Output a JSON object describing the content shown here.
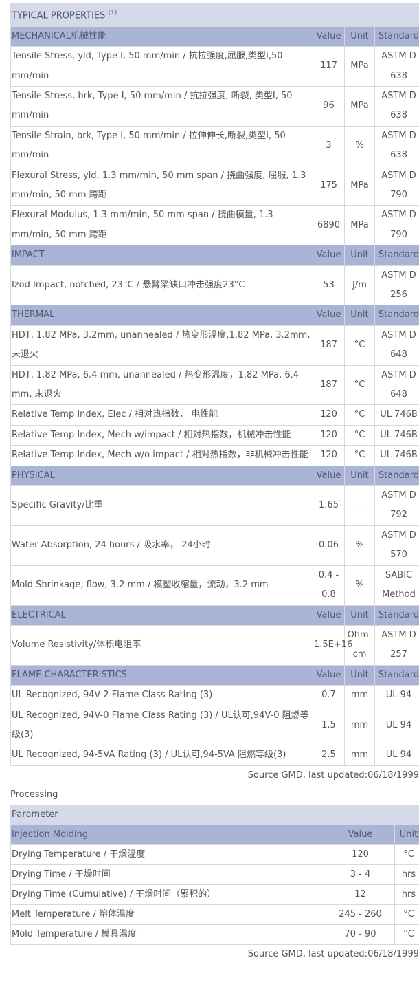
{
  "properties": {
    "title": "TYPICAL PROPERTIES",
    "title_sup": "(1)",
    "sections": [
      {
        "name": "MECHANICAL机械性能",
        "headers": [
          "Value",
          "Unit",
          "Standard"
        ],
        "rows": [
          {
            "name": "Tensile Stress, yld, Type I, 50 mm/min / 抗拉强度,屈服,类型I,50 mm/min",
            "value": "117",
            "unit": "MPa",
            "standard": "ASTM D 638"
          },
          {
            "name": "Tensile Stress, brk, Type I, 50 mm/min / 抗拉强度, 断裂, 类型I, 50 mm/min",
            "value": "96",
            "unit": "MPa",
            "standard": "ASTM D 638"
          },
          {
            "name": "Tensile Strain, brk, Type I, 50 mm/min / 拉伸伸长,断裂,类型I, 50 mm/min",
            "value": "3",
            "unit": "%",
            "standard": "ASTM D 638"
          },
          {
            "name": "Flexural Stress, yld, 1.3 mm/min, 50 mm span / 挠曲强度, 屈服, 1.3 mm/min, 50 mm 跨距",
            "value": "175",
            "unit": "MPa",
            "standard": "ASTM D 790"
          },
          {
            "name": "Flexural Modulus, 1.3 mm/min, 50 mm span / 挠曲模量, 1.3 mm/min, 50 mm 跨距",
            "value": "6890",
            "unit": "MPa",
            "standard": "ASTM D 790"
          }
        ]
      },
      {
        "name": "IMPACT",
        "headers": [
          "Value",
          "Unit",
          "Standard"
        ],
        "rows": [
          {
            "name": "Izod Impact, notched, 23°C / 悬臂梁缺口冲击强度23°C",
            "value": "53",
            "unit": "J/m",
            "standard": "ASTM D 256"
          }
        ]
      },
      {
        "name": "THERMAL",
        "headers": [
          "Value",
          "Unit",
          "Standard"
        ],
        "rows": [
          {
            "name": "HDT, 1.82 MPa, 3.2mm, unannealed / 热变形温度,1.82 MPa, 3.2mm,未退火",
            "value": "187",
            "unit": "°C",
            "standard": "ASTM D 648"
          },
          {
            "name": "HDT, 1.82 MPa, 6.4 mm, unannealed / 热变形温度，1.82 MPa, 6.4 mm, 未退火",
            "value": "187",
            "unit": "°C",
            "standard": "ASTM D 648"
          },
          {
            "name": "Relative Temp Index, Elec / 相对热指数， 电性能",
            "value": "120",
            "unit": "°C",
            "standard": "UL 746B"
          },
          {
            "name": "Relative Temp Index, Mech w/impact / 相对热指数，机械冲击性能",
            "value": "120",
            "unit": "°C",
            "standard": "UL 746B"
          },
          {
            "name": "Relative Temp Index, Mech w/o impact / 相对热指数，非机械冲击性能",
            "value": "120",
            "unit": "°C",
            "standard": "UL 746B"
          }
        ]
      },
      {
        "name": "PHYSICAL",
        "headers": [
          "Value",
          "Unit",
          "Standard"
        ],
        "rows": [
          {
            "name": "Specific Gravity/比重",
            "value": "1.65",
            "unit": "-",
            "standard": "ASTM D 792"
          },
          {
            "name": "Water Absorption, 24 hours / 吸水率， 24小时",
            "value": "0.06",
            "unit": "%",
            "standard": "ASTM D 570"
          },
          {
            "name": "Mold Shrinkage, flow, 3.2 mm / 模塑收缩量，流动，3.2 mm",
            "value": "0.4 - 0.8",
            "unit": "%",
            "standard": "SABIC Method"
          }
        ]
      },
      {
        "name": "ELECTRICAL",
        "headers": [
          "Value",
          "Unit",
          "Standard"
        ],
        "rows": [
          {
            "name": "Volume Resistivity/体积电阻率",
            "value": "1.5E+16",
            "unit": "Ohm-cm",
            "standard": "ASTM D 257"
          }
        ]
      },
      {
        "name": "FLAME CHARACTERISTICS",
        "headers": [
          "Value",
          "Unit",
          "Standard"
        ],
        "rows": [
          {
            "name": "UL Recognized, 94V-2 Flame Class Rating (3)",
            "value": "0.7",
            "unit": "mm",
            "standard": "UL 94"
          },
          {
            "name": "UL Recognized, 94V-0 Flame Class Rating (3) / UL认可,94V-0 阻燃等级(3)",
            "value": "1.5",
            "unit": "mm",
            "standard": "UL 94"
          },
          {
            "name": "UL Recognized, 94-5VA Rating (3) / UL认可,94-5VA 阻燃等级(3)",
            "value": "2.5",
            "unit": "mm",
            "standard": "UL 94"
          }
        ]
      }
    ],
    "source": "Source GMD, last updated:06/18/1999"
  },
  "processing": {
    "label": "Processing",
    "title": "Parameter",
    "section": "Injection Molding",
    "headers": [
      "Value",
      "Unit"
    ],
    "rows": [
      {
        "name": "Drying Temperature / 干燥温度",
        "value": "120",
        "unit": "°C"
      },
      {
        "name": "Drying Time / 干燥时间",
        "value": "3 - 4",
        "unit": "hrs"
      },
      {
        "name": "Drying Time (Cumulative) / 干燥时间（累积的）",
        "value": "12",
        "unit": "hrs"
      },
      {
        "name": "Melt Temperature / 熔体温度",
        "value": "245 - 260",
        "unit": "°C"
      },
      {
        "name": "Mold Temperature / 模具温度",
        "value": "70 - 90",
        "unit": "°C"
      }
    ],
    "source": "Source GMD, last updated:06/18/1999"
  }
}
